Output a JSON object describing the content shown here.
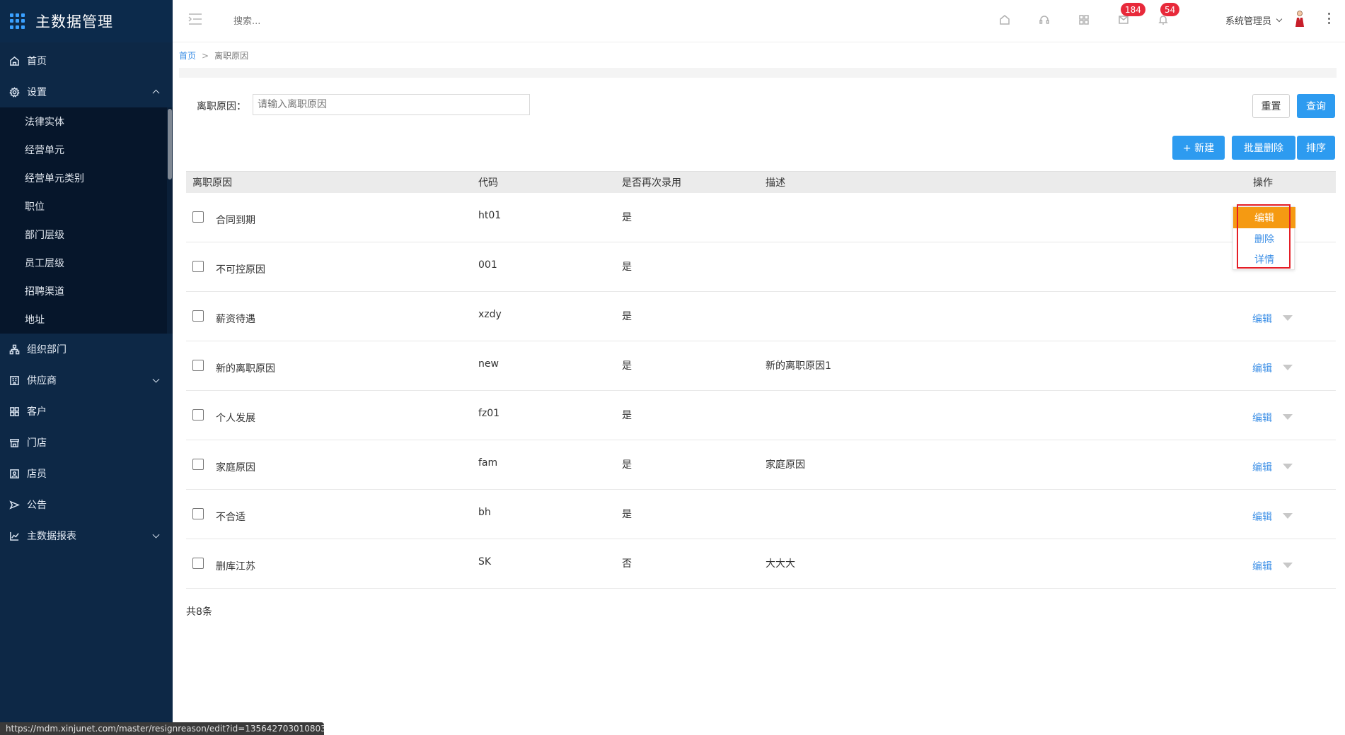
{
  "app": {
    "title": "主数据管理"
  },
  "sidebar": {
    "items": [
      {
        "label": "首页",
        "icon": "home-icon"
      },
      {
        "label": "设置",
        "icon": "gear-icon",
        "expanded": true
      },
      {
        "label": "组织部门",
        "icon": "org-icon"
      },
      {
        "label": "供应商",
        "icon": "building-icon",
        "expandable": true
      },
      {
        "label": "客户",
        "icon": "customer-icon"
      },
      {
        "label": "门店",
        "icon": "store-icon"
      },
      {
        "label": "店员",
        "icon": "staff-icon"
      },
      {
        "label": "公告",
        "icon": "announcement-icon"
      },
      {
        "label": "主数据报表",
        "icon": "chart-icon",
        "expandable": true
      }
    ],
    "settings_sub": [
      "法律实体",
      "经营单元",
      "经营单元类别",
      "职位",
      "部门层级",
      "员工层级",
      "招聘渠道",
      "地址"
    ]
  },
  "header": {
    "search_placeholder": "搜索...",
    "badge_messages": "184",
    "badge_notifications": "54",
    "user_name": "系统管理员"
  },
  "breadcrumb": {
    "home": "首页",
    "sep": ">",
    "current": "离职原因"
  },
  "filter": {
    "label": "离职原因：",
    "placeholder": "请输入离职原因"
  },
  "buttons": {
    "reset": "重置",
    "query": "查询",
    "new": "+ 新建",
    "batch_delete": "批量删除",
    "sort": "排序"
  },
  "table": {
    "headers": [
      "离职原因",
      "代码",
      "是否再次录用",
      "描述",
      "操作"
    ],
    "rows": [
      {
        "reason": "合同到期",
        "code": "ht01",
        "rehire": "是",
        "desc": ""
      },
      {
        "reason": "不可控原因",
        "code": "001",
        "rehire": "是",
        "desc": ""
      },
      {
        "reason": "薪资待遇",
        "code": "xzdy",
        "rehire": "是",
        "desc": ""
      },
      {
        "reason": "新的离职原因",
        "code": "new",
        "rehire": "是",
        "desc": "新的离职原因1"
      },
      {
        "reason": "个人发展",
        "code": "fz01",
        "rehire": "是",
        "desc": ""
      },
      {
        "reason": "家庭原因",
        "code": "fam",
        "rehire": "是",
        "desc": "家庭原因"
      },
      {
        "reason": "不合适",
        "code": "bh",
        "rehire": "是",
        "desc": ""
      },
      {
        "reason": "删库江苏",
        "code": "SK",
        "rehire": "否",
        "desc": "大大大"
      }
    ],
    "edit_label": "编辑",
    "dropdown": {
      "edit": "编辑",
      "delete": "删除",
      "detail": "详情"
    },
    "total": "共8条"
  },
  "status_url": "https://mdm.xinjunet.com/master/resignreason/edit?id=1356427030108030168",
  "colors": {
    "sidebar_bg": "#0d2846",
    "accent": "#2d9bf0",
    "highlight": "#f59a12",
    "badge": "#e8293a"
  }
}
